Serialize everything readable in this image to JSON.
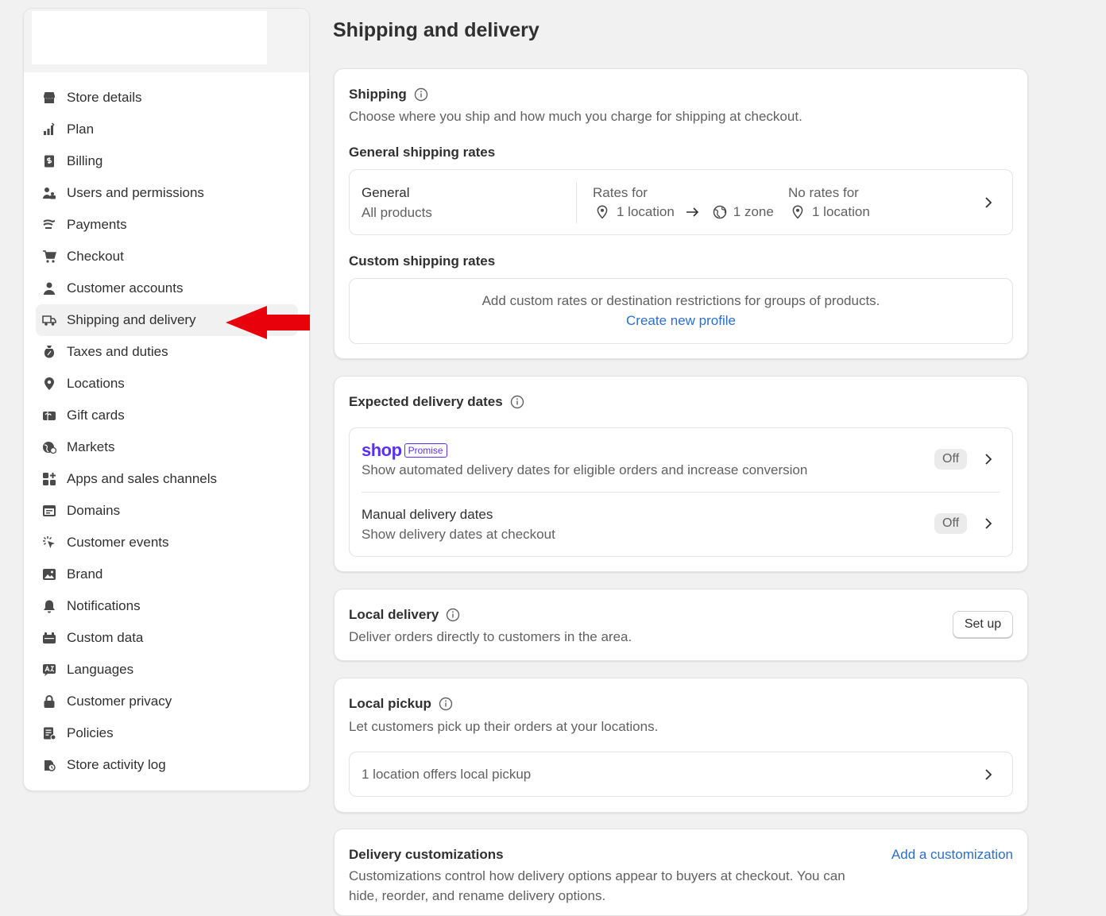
{
  "sidebar": {
    "items": [
      {
        "label": "Store details",
        "icon": "store-icon"
      },
      {
        "label": "Plan",
        "icon": "plan-icon"
      },
      {
        "label": "Billing",
        "icon": "billing-icon"
      },
      {
        "label": "Users and permissions",
        "icon": "users-icon"
      },
      {
        "label": "Payments",
        "icon": "payments-icon"
      },
      {
        "label": "Checkout",
        "icon": "cart-icon"
      },
      {
        "label": "Customer accounts",
        "icon": "person-icon"
      },
      {
        "label": "Shipping and delivery",
        "icon": "truck-icon",
        "active": true
      },
      {
        "label": "Taxes and duties",
        "icon": "tax-icon"
      },
      {
        "label": "Locations",
        "icon": "location-icon"
      },
      {
        "label": "Gift cards",
        "icon": "gift-card-icon"
      },
      {
        "label": "Markets",
        "icon": "globe-icon"
      },
      {
        "label": "Apps and sales channels",
        "icon": "apps-icon"
      },
      {
        "label": "Domains",
        "icon": "domains-icon"
      },
      {
        "label": "Customer events",
        "icon": "cursor-click-icon"
      },
      {
        "label": "Brand",
        "icon": "brand-icon"
      },
      {
        "label": "Notifications",
        "icon": "bell-icon"
      },
      {
        "label": "Custom data",
        "icon": "custom-data-icon"
      },
      {
        "label": "Languages",
        "icon": "language-icon"
      },
      {
        "label": "Customer privacy",
        "icon": "lock-icon"
      },
      {
        "label": "Policies",
        "icon": "policies-icon"
      },
      {
        "label": "Store activity log",
        "icon": "activity-log-icon"
      }
    ]
  },
  "page": {
    "title": "Shipping and delivery"
  },
  "shipping": {
    "title": "Shipping",
    "description": "Choose where you ship and how much you charge for shipping at checkout.",
    "general_heading": "General shipping rates",
    "general_profile": {
      "name": "General",
      "products": "All products",
      "rates_for_label": "Rates for",
      "rates_location": "1 location",
      "rates_zone": "1 zone",
      "no_rates_label": "No rates for",
      "no_rates_location": "1 location"
    },
    "custom_heading": "Custom shipping rates",
    "custom_text": "Add custom rates or destination restrictions for groups of products.",
    "custom_link": "Create new profile"
  },
  "delivery_dates": {
    "title": "Expected delivery dates",
    "shop_brand": "shop",
    "shop_badge": "Promise",
    "shop_description": "Show automated delivery dates for eligible orders and increase conversion",
    "shop_status": "Off",
    "manual_title": "Manual delivery dates",
    "manual_description": "Show delivery dates at checkout",
    "manual_status": "Off"
  },
  "local_delivery": {
    "title": "Local delivery",
    "description": "Deliver orders directly to customers in the area.",
    "button": "Set up"
  },
  "local_pickup": {
    "title": "Local pickup",
    "description": "Let customers pick up their orders at your locations.",
    "row": "1 location offers local pickup"
  },
  "delivery_customizations": {
    "title": "Delivery customizations",
    "description": "Customizations control how delivery options appear to buyers at checkout. You can hide, reorder, and rename delivery options.",
    "link": "Add a customization"
  },
  "colors": {
    "accent": "#2c6ecb",
    "shop_purple": "#5a31f4",
    "arrow_red": "#e8000b"
  }
}
